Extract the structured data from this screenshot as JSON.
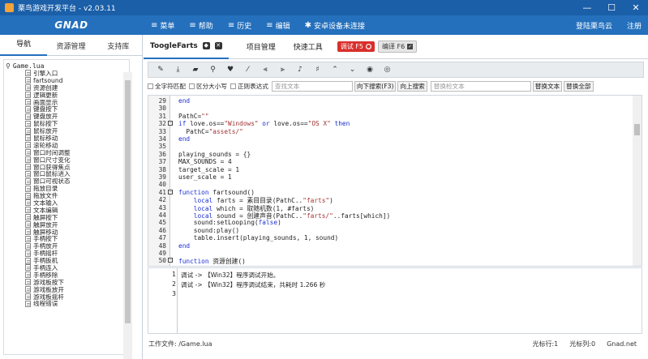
{
  "window": {
    "title": "栗鸟游戏开发平台 - v2.03.11",
    "min": "—",
    "max": "☐",
    "close": "✕"
  },
  "menubar": {
    "brand": "GNAD",
    "items": [
      {
        "icon": "≡",
        "label": "菜单"
      },
      {
        "icon": "≡",
        "label": "帮助"
      },
      {
        "icon": "≡",
        "label": "历史"
      },
      {
        "icon": "≡",
        "label": "编辑"
      },
      {
        "icon": "✱",
        "label": "安卓设备未连接"
      }
    ],
    "login": "登陆栗鸟云",
    "register": "注册"
  },
  "left": {
    "tabs": [
      "导航",
      "资源管理",
      "支持库"
    ],
    "root": "Game.lua",
    "items": [
      "引擎入口",
      "fartsound",
      "资源创建",
      "逻辑更新",
      "画面显示",
      "键盘按下",
      "键盘放开",
      "鼠标按下",
      "鼠标放开",
      "鼠标移动",
      "滚轮移动",
      "窗口时间调整",
      "窗口尺寸变化",
      "窗口获得焦点",
      "窗口鼠标进入",
      "窗口可视状态",
      "拖放目录",
      "拖放文件",
      "文本输入",
      "文本编辑",
      "触屏按下",
      "触屏放开",
      "触屏移动",
      "手柄按下",
      "手柄放开",
      "手柄摇杆",
      "手柄扳机",
      "手柄连入",
      "手柄移除",
      "游戏板按下",
      "游戏板放开",
      "游戏板摇杆",
      "线程错误"
    ]
  },
  "editor": {
    "doc_tab": "ToogleFarts",
    "tab2": "项目管理",
    "tab3": "快速工具",
    "debug": "调试 F5",
    "compile": "编译 F6",
    "find": {
      "opt1": "全字符匹配",
      "opt2": "区分大小写",
      "opt3": "正则表达式",
      "search_placeholder": "查找文本",
      "down": "向下搜索(F3)",
      "up": "向上搜索",
      "replace_placeholder": "替换检文本",
      "replace": "替换文本",
      "replace_all": "替换全部"
    },
    "lines": [
      {
        "n": "29",
        "text": "end",
        "fold": ""
      },
      {
        "n": "30",
        "text": "",
        "fold": ""
      },
      {
        "n": "31",
        "text": "PathC=\"\"",
        "fold": ""
      },
      {
        "n": "32",
        "text": "if love.os==\"Windows\" or love.os==\"OS X\" then",
        "fold": "−"
      },
      {
        "n": "33",
        "text": "  PathC=\"assets/\"",
        "fold": ""
      },
      {
        "n": "34",
        "text": "end",
        "fold": ""
      },
      {
        "n": "35",
        "text": "",
        "fold": ""
      },
      {
        "n": "36",
        "text": "playing_sounds = {}",
        "fold": ""
      },
      {
        "n": "37",
        "text": "MAX_SOUNDS = 4",
        "fold": ""
      },
      {
        "n": "38",
        "text": "target_scale = 1",
        "fold": ""
      },
      {
        "n": "39",
        "text": "user_scale = 1",
        "fold": ""
      },
      {
        "n": "40",
        "text": "",
        "fold": ""
      },
      {
        "n": "41",
        "text": "function fartsound()",
        "fold": "−"
      },
      {
        "n": "42",
        "text": "    local farts = 素目目录(PathC..\"farts\")",
        "fold": ""
      },
      {
        "n": "43",
        "text": "    local which = 取随机数(1, #farts)",
        "fold": ""
      },
      {
        "n": "44",
        "text": "    local sound = 创建声音(PathC..\"farts/\"..farts[which])",
        "fold": ""
      },
      {
        "n": "45",
        "text": "    sound:setLooping(false)",
        "fold": ""
      },
      {
        "n": "46",
        "text": "    sound:play()",
        "fold": ""
      },
      {
        "n": "47",
        "text": "    table.insert(playing_sounds, 1, sound)",
        "fold": ""
      },
      {
        "n": "48",
        "text": "end",
        "fold": ""
      },
      {
        "n": "49",
        "text": "",
        "fold": ""
      },
      {
        "n": "50",
        "text": "function 资源创建()",
        "fold": "−"
      }
    ],
    "console": [
      {
        "n": "1",
        "text": "调试 -> 【Win32】程序调试开始。"
      },
      {
        "n": "2",
        "text": "调试 -> 【Win32】程序调试结束，共耗时 1.266 秒"
      },
      {
        "n": "3",
        "text": ""
      }
    ]
  },
  "status": {
    "file": "工作文件: /Game.lua",
    "row": "光标行:1",
    "col": "光标列:0",
    "site": "Gnad.net"
  }
}
